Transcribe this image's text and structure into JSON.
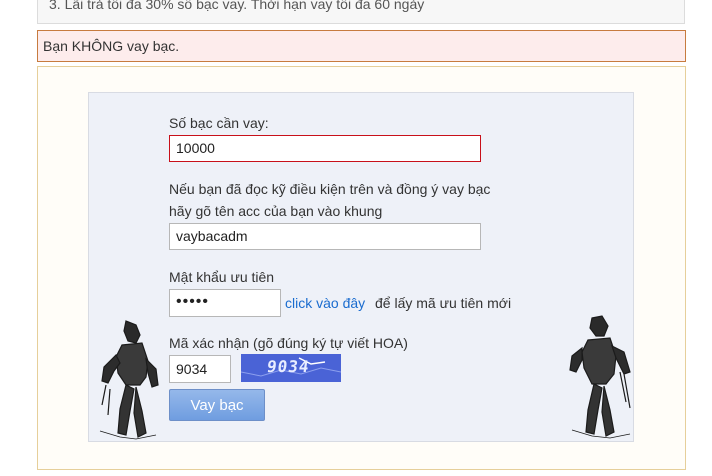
{
  "top_notice": "3. Lãi trả tối đa 30% số bạc vay. Thời hạn vay tối đa 60 ngày",
  "alert": "Bạn KHÔNG vay bạc.",
  "form": {
    "amount_label": "Số bạc cần vay:",
    "amount_value": "10000",
    "agree_text_line1": "Nếu bạn đã đọc kỹ điều kiện trên và đồng ý vay bạc",
    "agree_text_line2": "hãy gõ tên acc của bạn vào khung",
    "account_value": "vaybacadm",
    "priority_label": "Mật khẩu ưu tiên",
    "priority_value": "•••••",
    "priority_link": "click vào đây",
    "priority_link_suffix": "để lấy mã ưu tiên mới",
    "captcha_label": "Mã xác nhận (gõ đúng ký tự viết HOA)",
    "captcha_value": "9034",
    "captcha_image_text": "9034",
    "submit_label": "Vay bạc"
  },
  "colors": {
    "alert_bg": "#fdecec",
    "alert_border": "#c77b3f",
    "panel_bg": "#eef1f8",
    "error_border": "#c8101a",
    "button": "#7fa7e4",
    "captcha_bg": "#4a63d6",
    "link": "#1a6ccf"
  }
}
